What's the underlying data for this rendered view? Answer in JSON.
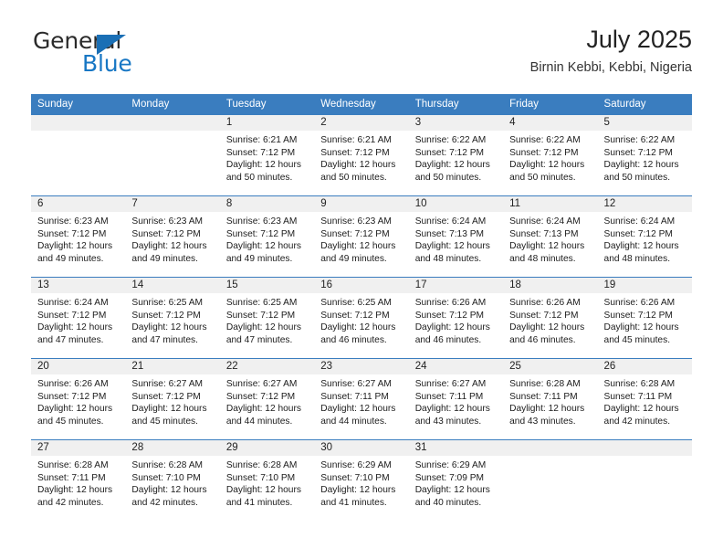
{
  "brand": {
    "name_part1": "General",
    "name_part2": "Blue",
    "accent_color": "#1877c4"
  },
  "header": {
    "title": "July 2025",
    "subtitle": "Birnin Kebbi, Kebbi, Nigeria"
  },
  "calendar": {
    "header_bg": "#3a7dbf",
    "daynum_bg": "#f0f0f0",
    "weekdays": [
      "Sunday",
      "Monday",
      "Tuesday",
      "Wednesday",
      "Thursday",
      "Friday",
      "Saturday"
    ],
    "weeks": [
      [
        {
          "day": "",
          "sunrise": "",
          "sunset": "",
          "daylight_line1": "",
          "daylight_line2": ""
        },
        {
          "day": "",
          "sunrise": "",
          "sunset": "",
          "daylight_line1": "",
          "daylight_line2": ""
        },
        {
          "day": "1",
          "sunrise": "Sunrise: 6:21 AM",
          "sunset": "Sunset: 7:12 PM",
          "daylight_line1": "Daylight: 12 hours",
          "daylight_line2": "and 50 minutes."
        },
        {
          "day": "2",
          "sunrise": "Sunrise: 6:21 AM",
          "sunset": "Sunset: 7:12 PM",
          "daylight_line1": "Daylight: 12 hours",
          "daylight_line2": "and 50 minutes."
        },
        {
          "day": "3",
          "sunrise": "Sunrise: 6:22 AM",
          "sunset": "Sunset: 7:12 PM",
          "daylight_line1": "Daylight: 12 hours",
          "daylight_line2": "and 50 minutes."
        },
        {
          "day": "4",
          "sunrise": "Sunrise: 6:22 AM",
          "sunset": "Sunset: 7:12 PM",
          "daylight_line1": "Daylight: 12 hours",
          "daylight_line2": "and 50 minutes."
        },
        {
          "day": "5",
          "sunrise": "Sunrise: 6:22 AM",
          "sunset": "Sunset: 7:12 PM",
          "daylight_line1": "Daylight: 12 hours",
          "daylight_line2": "and 50 minutes."
        }
      ],
      [
        {
          "day": "6",
          "sunrise": "Sunrise: 6:23 AM",
          "sunset": "Sunset: 7:12 PM",
          "daylight_line1": "Daylight: 12 hours",
          "daylight_line2": "and 49 minutes."
        },
        {
          "day": "7",
          "sunrise": "Sunrise: 6:23 AM",
          "sunset": "Sunset: 7:12 PM",
          "daylight_line1": "Daylight: 12 hours",
          "daylight_line2": "and 49 minutes."
        },
        {
          "day": "8",
          "sunrise": "Sunrise: 6:23 AM",
          "sunset": "Sunset: 7:12 PM",
          "daylight_line1": "Daylight: 12 hours",
          "daylight_line2": "and 49 minutes."
        },
        {
          "day": "9",
          "sunrise": "Sunrise: 6:23 AM",
          "sunset": "Sunset: 7:12 PM",
          "daylight_line1": "Daylight: 12 hours",
          "daylight_line2": "and 49 minutes."
        },
        {
          "day": "10",
          "sunrise": "Sunrise: 6:24 AM",
          "sunset": "Sunset: 7:13 PM",
          "daylight_line1": "Daylight: 12 hours",
          "daylight_line2": "and 48 minutes."
        },
        {
          "day": "11",
          "sunrise": "Sunrise: 6:24 AM",
          "sunset": "Sunset: 7:13 PM",
          "daylight_line1": "Daylight: 12 hours",
          "daylight_line2": "and 48 minutes."
        },
        {
          "day": "12",
          "sunrise": "Sunrise: 6:24 AM",
          "sunset": "Sunset: 7:12 PM",
          "daylight_line1": "Daylight: 12 hours",
          "daylight_line2": "and 48 minutes."
        }
      ],
      [
        {
          "day": "13",
          "sunrise": "Sunrise: 6:24 AM",
          "sunset": "Sunset: 7:12 PM",
          "daylight_line1": "Daylight: 12 hours",
          "daylight_line2": "and 47 minutes."
        },
        {
          "day": "14",
          "sunrise": "Sunrise: 6:25 AM",
          "sunset": "Sunset: 7:12 PM",
          "daylight_line1": "Daylight: 12 hours",
          "daylight_line2": "and 47 minutes."
        },
        {
          "day": "15",
          "sunrise": "Sunrise: 6:25 AM",
          "sunset": "Sunset: 7:12 PM",
          "daylight_line1": "Daylight: 12 hours",
          "daylight_line2": "and 47 minutes."
        },
        {
          "day": "16",
          "sunrise": "Sunrise: 6:25 AM",
          "sunset": "Sunset: 7:12 PM",
          "daylight_line1": "Daylight: 12 hours",
          "daylight_line2": "and 46 minutes."
        },
        {
          "day": "17",
          "sunrise": "Sunrise: 6:26 AM",
          "sunset": "Sunset: 7:12 PM",
          "daylight_line1": "Daylight: 12 hours",
          "daylight_line2": "and 46 minutes."
        },
        {
          "day": "18",
          "sunrise": "Sunrise: 6:26 AM",
          "sunset": "Sunset: 7:12 PM",
          "daylight_line1": "Daylight: 12 hours",
          "daylight_line2": "and 46 minutes."
        },
        {
          "day": "19",
          "sunrise": "Sunrise: 6:26 AM",
          "sunset": "Sunset: 7:12 PM",
          "daylight_line1": "Daylight: 12 hours",
          "daylight_line2": "and 45 minutes."
        }
      ],
      [
        {
          "day": "20",
          "sunrise": "Sunrise: 6:26 AM",
          "sunset": "Sunset: 7:12 PM",
          "daylight_line1": "Daylight: 12 hours",
          "daylight_line2": "and 45 minutes."
        },
        {
          "day": "21",
          "sunrise": "Sunrise: 6:27 AM",
          "sunset": "Sunset: 7:12 PM",
          "daylight_line1": "Daylight: 12 hours",
          "daylight_line2": "and 45 minutes."
        },
        {
          "day": "22",
          "sunrise": "Sunrise: 6:27 AM",
          "sunset": "Sunset: 7:12 PM",
          "daylight_line1": "Daylight: 12 hours",
          "daylight_line2": "and 44 minutes."
        },
        {
          "day": "23",
          "sunrise": "Sunrise: 6:27 AM",
          "sunset": "Sunset: 7:11 PM",
          "daylight_line1": "Daylight: 12 hours",
          "daylight_line2": "and 44 minutes."
        },
        {
          "day": "24",
          "sunrise": "Sunrise: 6:27 AM",
          "sunset": "Sunset: 7:11 PM",
          "daylight_line1": "Daylight: 12 hours",
          "daylight_line2": "and 43 minutes."
        },
        {
          "day": "25",
          "sunrise": "Sunrise: 6:28 AM",
          "sunset": "Sunset: 7:11 PM",
          "daylight_line1": "Daylight: 12 hours",
          "daylight_line2": "and 43 minutes."
        },
        {
          "day": "26",
          "sunrise": "Sunrise: 6:28 AM",
          "sunset": "Sunset: 7:11 PM",
          "daylight_line1": "Daylight: 12 hours",
          "daylight_line2": "and 42 minutes."
        }
      ],
      [
        {
          "day": "27",
          "sunrise": "Sunrise: 6:28 AM",
          "sunset": "Sunset: 7:11 PM",
          "daylight_line1": "Daylight: 12 hours",
          "daylight_line2": "and 42 minutes."
        },
        {
          "day": "28",
          "sunrise": "Sunrise: 6:28 AM",
          "sunset": "Sunset: 7:10 PM",
          "daylight_line1": "Daylight: 12 hours",
          "daylight_line2": "and 42 minutes."
        },
        {
          "day": "29",
          "sunrise": "Sunrise: 6:28 AM",
          "sunset": "Sunset: 7:10 PM",
          "daylight_line1": "Daylight: 12 hours",
          "daylight_line2": "and 41 minutes."
        },
        {
          "day": "30",
          "sunrise": "Sunrise: 6:29 AM",
          "sunset": "Sunset: 7:10 PM",
          "daylight_line1": "Daylight: 12 hours",
          "daylight_line2": "and 41 minutes."
        },
        {
          "day": "31",
          "sunrise": "Sunrise: 6:29 AM",
          "sunset": "Sunset: 7:09 PM",
          "daylight_line1": "Daylight: 12 hours",
          "daylight_line2": "and 40 minutes."
        },
        {
          "day": "",
          "sunrise": "",
          "sunset": "",
          "daylight_line1": "",
          "daylight_line2": ""
        },
        {
          "day": "",
          "sunrise": "",
          "sunset": "",
          "daylight_line1": "",
          "daylight_line2": ""
        }
      ]
    ]
  }
}
